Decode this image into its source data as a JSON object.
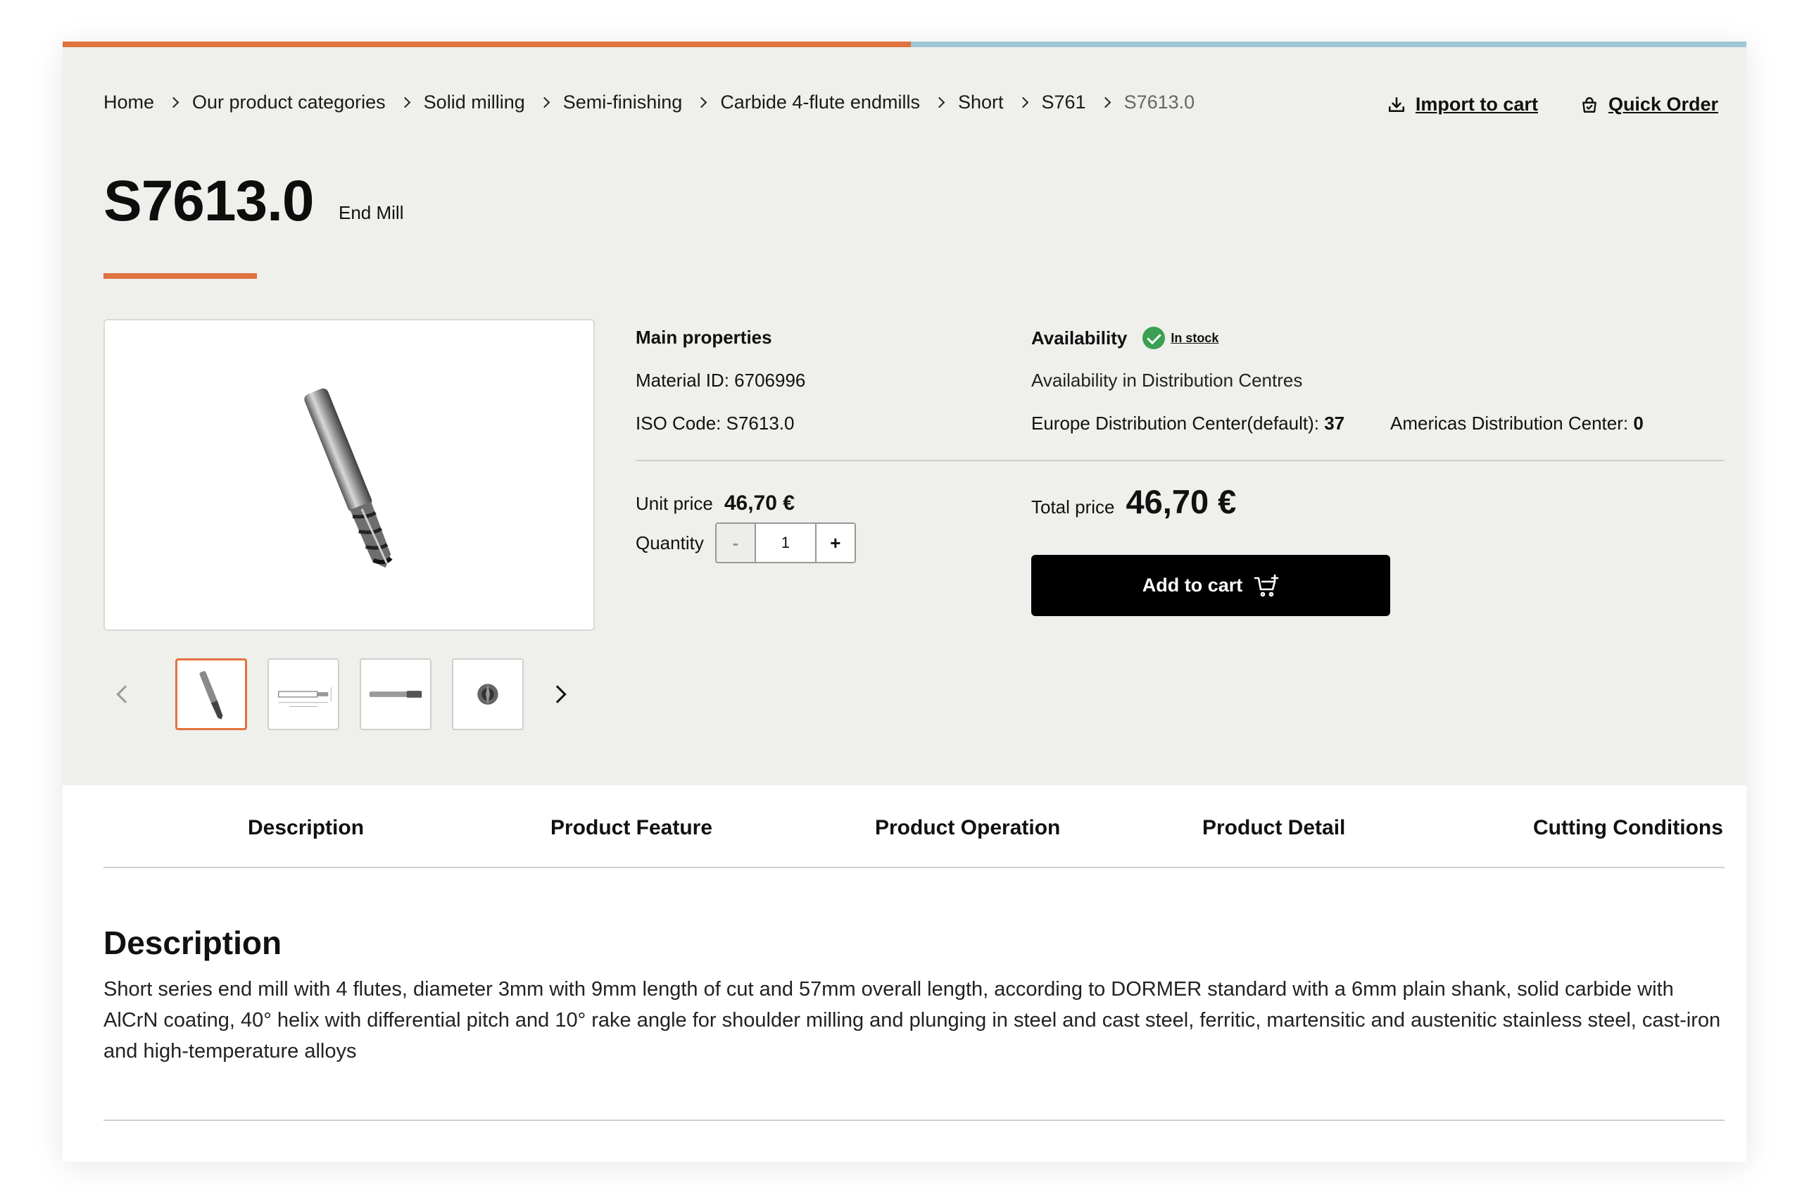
{
  "breadcrumb": {
    "items": [
      "Home",
      "Our product categories",
      "Solid milling",
      "Semi-finishing",
      "Carbide 4-flute endmills",
      "Short",
      "S761",
      "S7613.0"
    ]
  },
  "header_links": {
    "import_to_cart": "Import to cart",
    "quick_order": "Quick Order"
  },
  "product": {
    "code": "S7613.0",
    "type": "End Mill"
  },
  "main_properties": {
    "heading": "Main properties",
    "material_id": "Material ID: 6706996",
    "iso_code": "ISO Code: S7613.0"
  },
  "availability": {
    "heading": "Availability",
    "status": "In stock",
    "sub_heading": "Availability in Distribution Centres",
    "europe_label": "Europe Distribution Center(default):",
    "europe_value": "37",
    "americas_label": "Americas Distribution Center:",
    "americas_value": "0"
  },
  "pricing": {
    "unit_price_label": "Unit price",
    "unit_price_value": "46,70 €",
    "quantity_label": "Quantity",
    "quantity_value": "1",
    "minus": "-",
    "plus": "+",
    "total_label": "Total price",
    "total_value": "46,70 €",
    "add_to_cart": "Add to cart"
  },
  "tabs": [
    "Description",
    "Product Feature",
    "Product Operation",
    "Product Detail",
    "Cutting Conditions"
  ],
  "description": {
    "title": "Description",
    "text": "Short series end mill with 4 flutes, diameter 3mm with 9mm length of cut and 57mm overall length, according to DORMER standard with a 6mm plain shank, solid carbide with AlCrN coating, 40° helix with differential pitch and 10° rake angle for shoulder milling and plunging in steel and cast steel, ferritic, martensitic and austenitic stainless steel, cast-iron and high-temperature alloys"
  },
  "colors": {
    "accent": "#e0733f",
    "progress_track": "#9cc7d3",
    "hero_bg": "#efefec",
    "in_stock": "#3aa053"
  },
  "icons": {
    "import": "download-tray-icon",
    "quick_order": "shopping-bag-icon",
    "stock": "check-circle-icon",
    "cart": "cart-plus-icon"
  }
}
